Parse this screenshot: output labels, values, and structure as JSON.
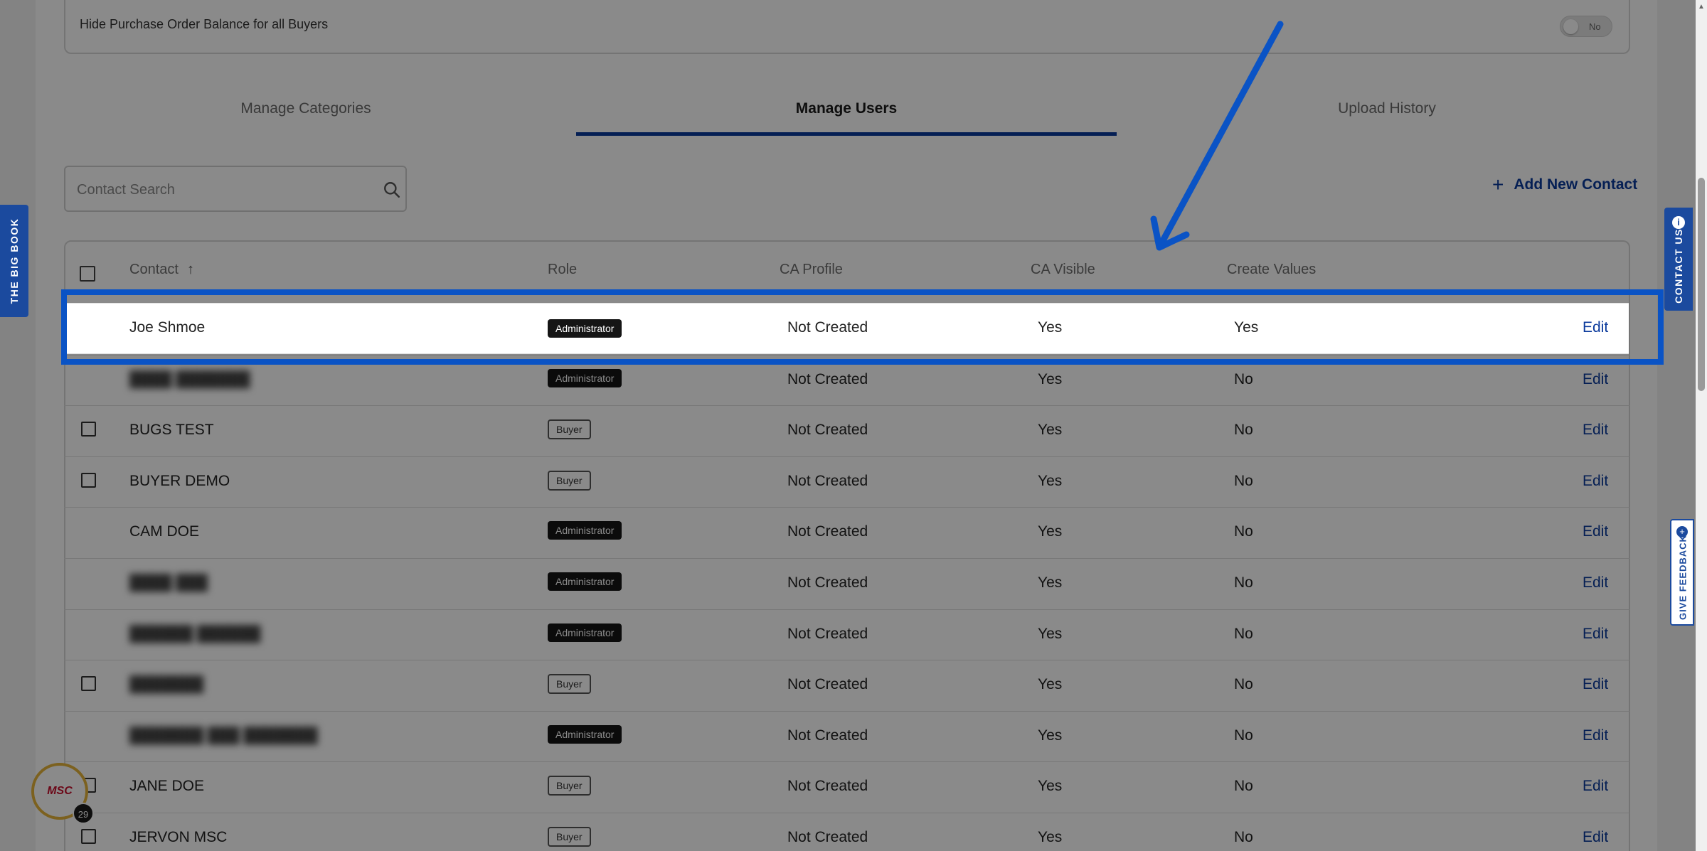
{
  "settings": {
    "label": "Hide Purchase Order Balance for all Buyers",
    "toggle_value": "No"
  },
  "tabs": [
    {
      "label": "Manage Categories"
    },
    {
      "label": "Manage Users"
    },
    {
      "label": "Upload History"
    }
  ],
  "search": {
    "placeholder": "Contact Search"
  },
  "add_contact_label": "Add New Contact",
  "table": {
    "headers": [
      "Contact",
      "Role",
      "CA Profile",
      "CA Visible",
      "Create Values"
    ],
    "edit_label": "Edit",
    "rows": [
      {
        "name": "Joe Shmoe",
        "role": "Administrator",
        "ca_profile": "Not Created",
        "ca_visible": "Yes",
        "create_values": "Yes",
        "checkbox": false
      },
      {
        "name": "████ ███████",
        "role": "Administrator",
        "ca_profile": "Not Created",
        "ca_visible": "Yes",
        "create_values": "No",
        "checkbox": false,
        "blurred": true
      },
      {
        "name": "BUGS TEST",
        "role": "Buyer",
        "ca_profile": "Not Created",
        "ca_visible": "Yes",
        "create_values": "No",
        "checkbox": true
      },
      {
        "name": "BUYER DEMO",
        "role": "Buyer",
        "ca_profile": "Not Created",
        "ca_visible": "Yes",
        "create_values": "No",
        "checkbox": true
      },
      {
        "name": "CAM DOE",
        "role": "Administrator",
        "ca_profile": "Not Created",
        "ca_visible": "Yes",
        "create_values": "No",
        "checkbox": false
      },
      {
        "name": "████ ███",
        "role": "Administrator",
        "ca_profile": "Not Created",
        "ca_visible": "Yes",
        "create_values": "No",
        "checkbox": false,
        "blurred": true
      },
      {
        "name": "██████ ██████",
        "role": "Administrator",
        "ca_profile": "Not Created",
        "ca_visible": "Yes",
        "create_values": "No",
        "checkbox": false,
        "blurred": true
      },
      {
        "name": "███████",
        "role": "Buyer",
        "ca_profile": "Not Created",
        "ca_visible": "Yes",
        "create_values": "No",
        "checkbox": true,
        "blurred": true
      },
      {
        "name": "███████ ███ ███████",
        "role": "Administrator",
        "ca_profile": "Not Created",
        "ca_visible": "Yes",
        "create_values": "No",
        "checkbox": false,
        "blurred": true
      },
      {
        "name": "JANE DOE",
        "role": "Buyer",
        "ca_profile": "Not Created",
        "ca_visible": "Yes",
        "create_values": "No",
        "checkbox": true
      },
      {
        "name": "JERVON MSC",
        "role": "Buyer",
        "ca_profile": "Not Created",
        "ca_visible": "Yes",
        "create_values": "No",
        "checkbox": true
      }
    ]
  },
  "side_tabs": {
    "big_book": "THE BIG BOOK",
    "contact_us": "CONTACT US",
    "feedback": "GIVE FEEDBACK"
  },
  "badge": {
    "logo": "MSC",
    "count": "29"
  },
  "colors": {
    "accent": "#0b3a9c",
    "highlight": "#0a53c5"
  }
}
